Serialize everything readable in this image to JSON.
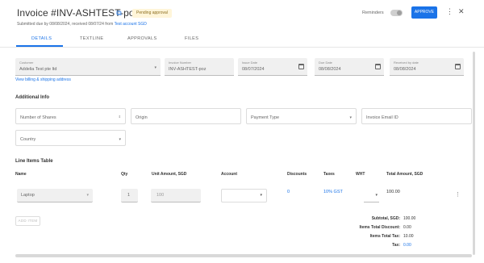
{
  "header": {
    "title": "Invoice #INV-ASHTEST-poz",
    "badge": "Pending approval",
    "subtitle_prefix": "Submitted due by 08/08/2024, received 08/07/24 from",
    "subtitle_link": "Test account SGD",
    "reminders_label": "Reminders",
    "approve_label": "APPROVE"
  },
  "tabs": [
    "Details",
    "Textline",
    "Approvals",
    "Files"
  ],
  "details": {
    "customer": {
      "label": "Customer",
      "value": "Addelia Test pte ltd"
    },
    "invoice_number": {
      "label": "Invoice Number",
      "value": "INV-ASHTEST-poz"
    },
    "issue_date": {
      "label": "Issue Date",
      "value": "08/07/2024"
    },
    "due_date": {
      "label": "Due Date",
      "value": "08/08/2024"
    },
    "received_date": {
      "label": "Received by date",
      "value": "08/08/2024"
    },
    "billing_link": "View billing & shipping address"
  },
  "additional_info": {
    "title": "Additional Info",
    "number_of_shares": "Number of Shares",
    "origin": "Origin",
    "payment_type": "Payment Type",
    "invoice_email": "Invoice Email ID",
    "country": "Country"
  },
  "line_items": {
    "title": "Line Items Table",
    "columns": [
      "Name",
      "Qty",
      "Unit Amount, SGD",
      "Account",
      "Discounts",
      "Taxes",
      "WHT",
      "Total Amount, SGD"
    ],
    "rows": [
      {
        "name": "Laptop",
        "qty": "1",
        "unit_amount": "100",
        "account": "",
        "discounts": "0",
        "taxes": "10% GST",
        "wht": "",
        "total": "100.00"
      }
    ],
    "add_label": "ADD ITEM"
  },
  "totals": [
    {
      "label": "Subtotal, SGD:",
      "value": "100.00"
    },
    {
      "label": "Items Total Discount:",
      "value": "0.00"
    },
    {
      "label": "Items Total Tax:",
      "value": "10.00"
    },
    {
      "label": "Tax:",
      "value": "0.00",
      "link": true
    }
  ],
  "colors": {
    "accent": "#1a73e8",
    "badge_bg": "#fff5d9"
  }
}
